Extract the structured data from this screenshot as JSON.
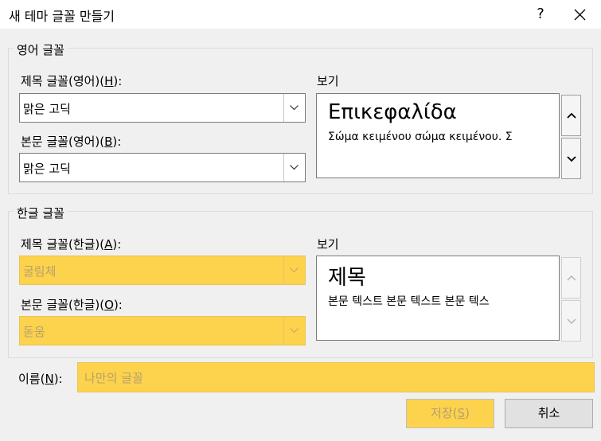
{
  "window": {
    "title": "새 테마 글꼴 만들기",
    "help_label": "?"
  },
  "latin": {
    "group_label": "영어 글꼴",
    "heading_label_pre": "제목 글꼴(영어)(",
    "heading_label_key": "H",
    "heading_label_post": "):",
    "heading_font": "맑은 고딕",
    "body_label_pre": "본문 글꼴(영어)(",
    "body_label_key": "B",
    "body_label_post": "):",
    "body_font": "맑은 고딕",
    "preview_label": "보기",
    "preview_heading": "Επικεφαλίδα",
    "preview_body": "Σώμα κειμένου σώμα κειμένου. Σ"
  },
  "korean": {
    "group_label": "한글 글꼴",
    "heading_label_pre": "제목 글꼴(한글)(",
    "heading_label_key": "A",
    "heading_label_post": "):",
    "heading_font": "굴림체",
    "body_label_pre": "본문 글꼴(한글)(",
    "body_label_key": "O",
    "body_label_post": "):",
    "body_font": "돋움",
    "preview_label": "보기",
    "preview_heading": "제목",
    "preview_body": "본문 텍스트 본문 텍스트 본문 텍스"
  },
  "name": {
    "label_pre": "이름(",
    "label_key": "N",
    "label_post": "):",
    "placeholder": "나만의 글꼴"
  },
  "buttons": {
    "save_pre": "저장(",
    "save_key": "S",
    "save_post": ")",
    "cancel": "취소"
  },
  "colors": {
    "highlight": "#fdd24d",
    "border": "#7a7a7a"
  },
  "icons": {
    "close": "close-icon",
    "help": "help-icon",
    "dropdown": "chevron-down-icon",
    "scroll_up": "chevron-up-icon",
    "scroll_down": "chevron-down-icon"
  }
}
